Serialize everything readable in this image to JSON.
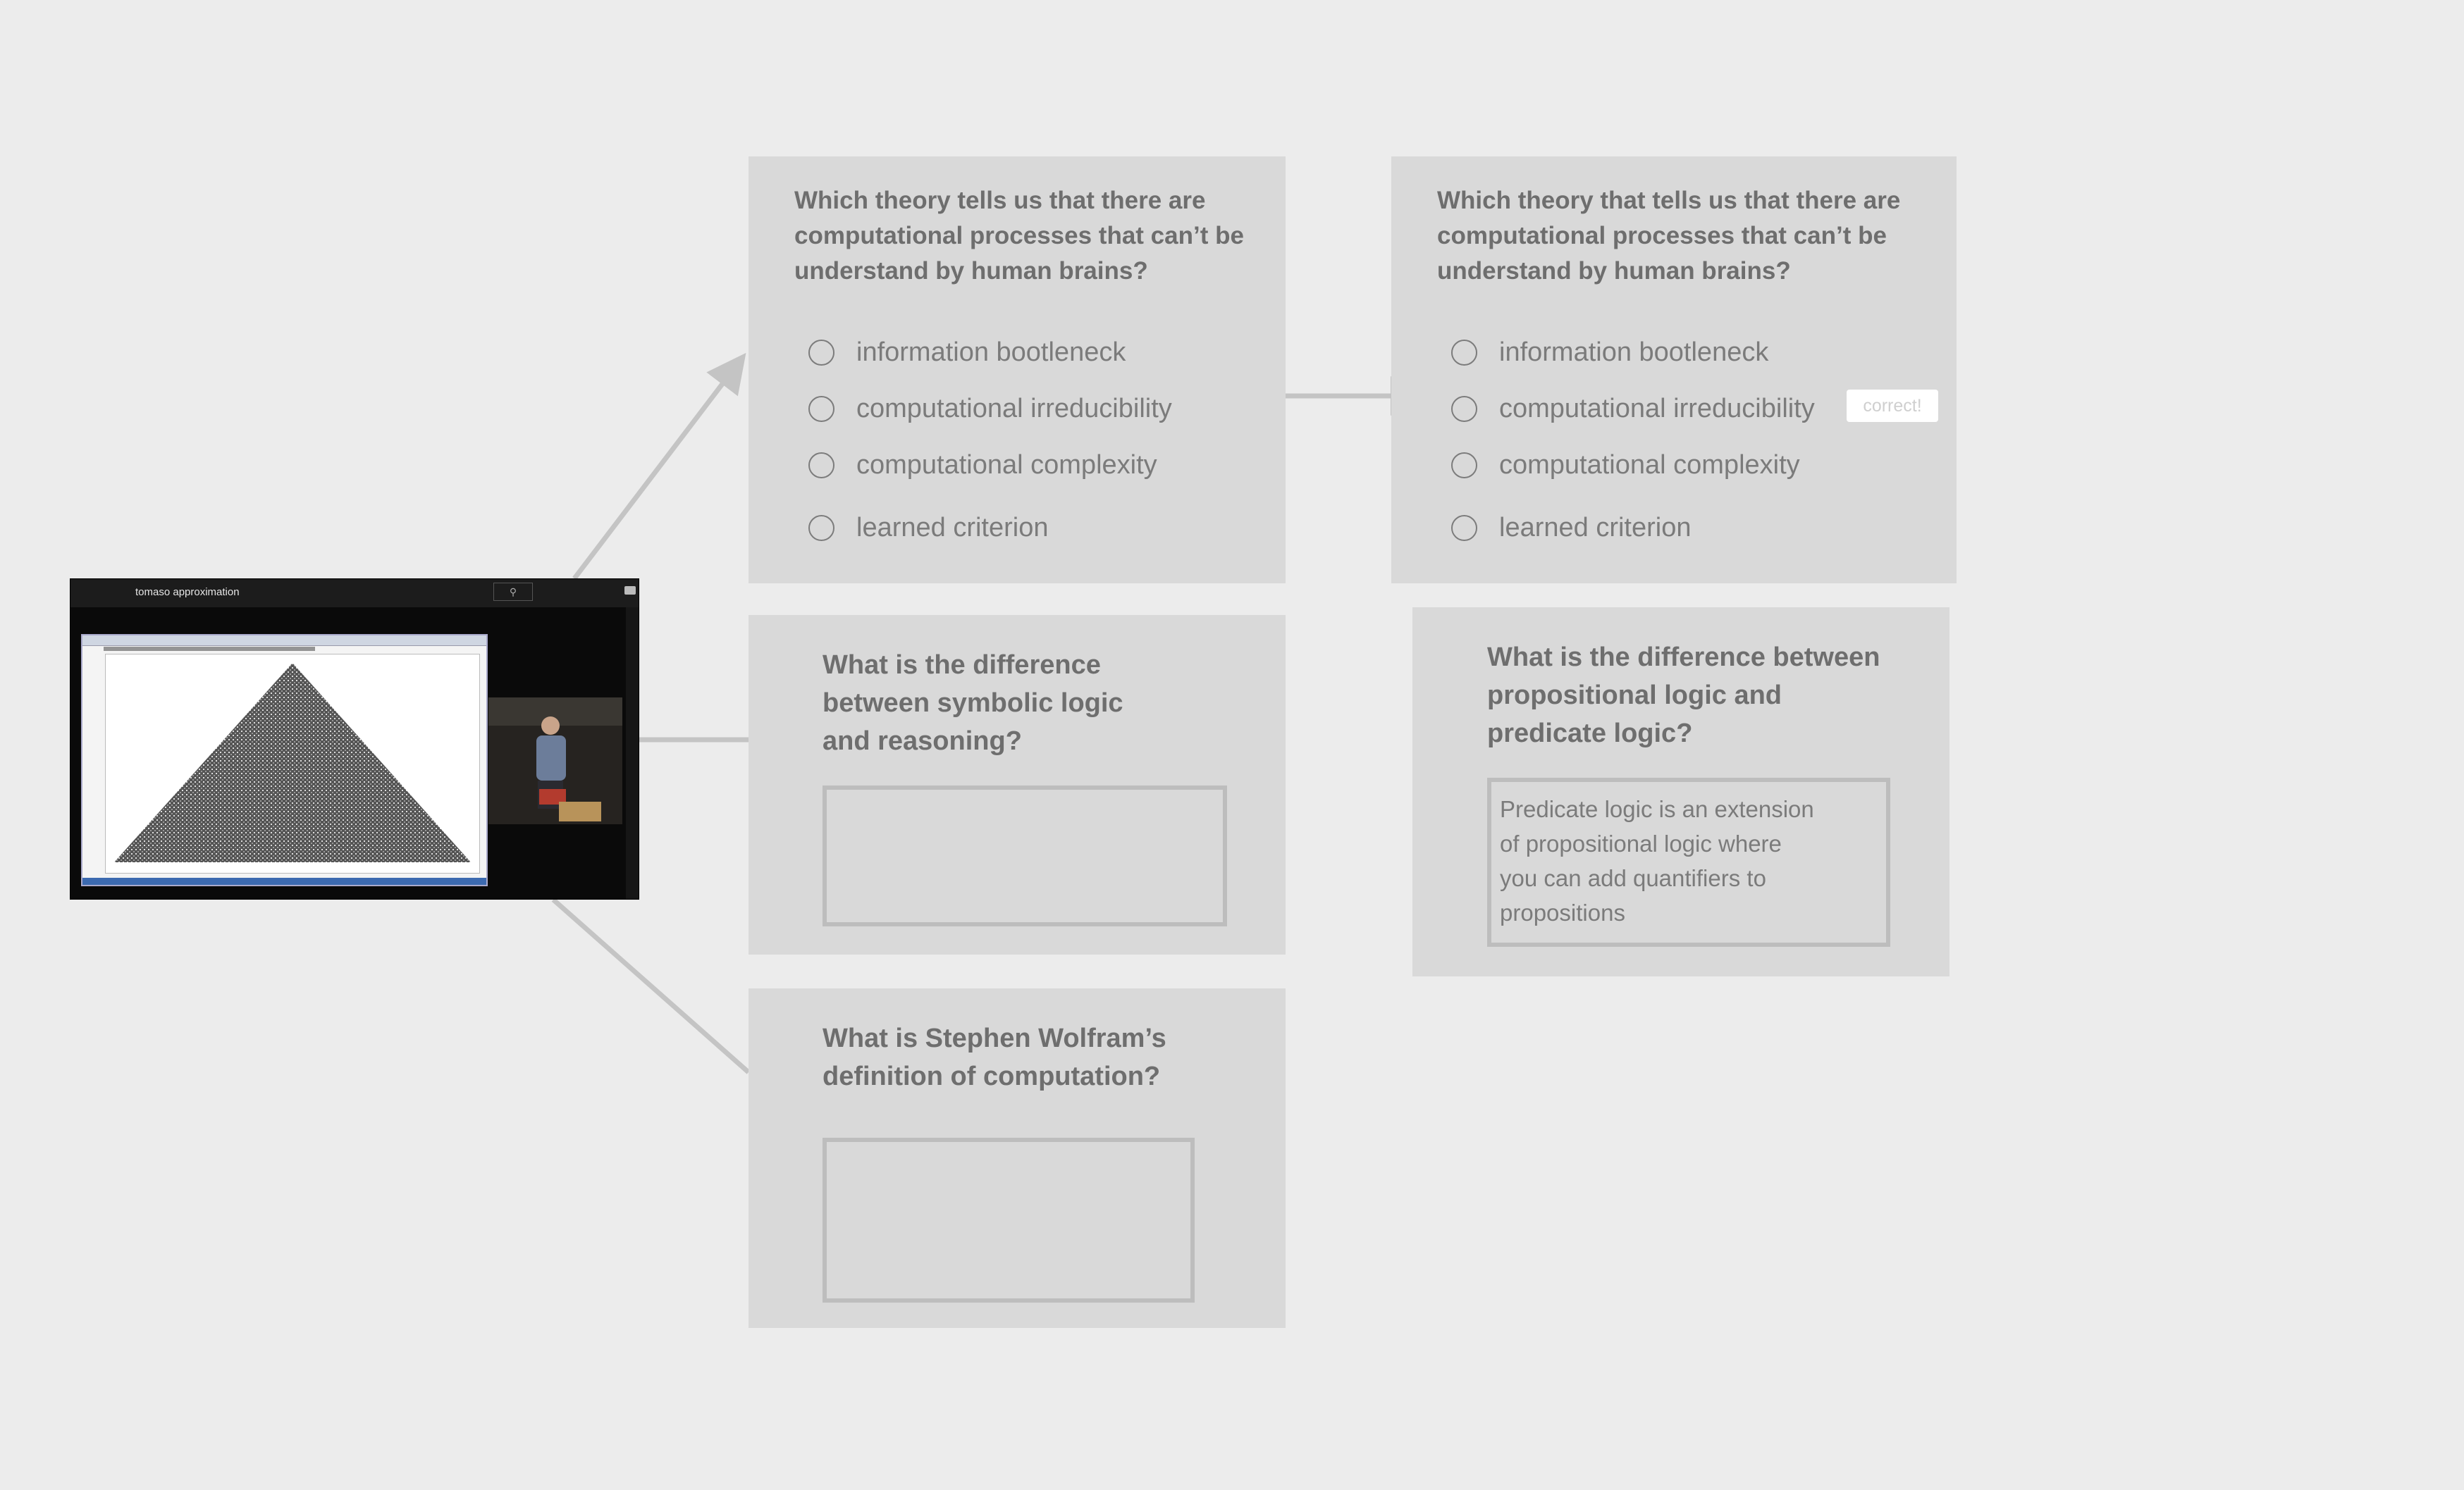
{
  "video": {
    "search_query": "tomaso approximation",
    "search_icon": "search-icon",
    "camera_icon": "video-camera-icon"
  },
  "quizzes": {
    "mc_unanswered": {
      "question": "Which theory tells us that there are computational processes that can’t be understand by human brains?",
      "options": [
        "information bootleneck",
        "computational irreducibility",
        "computational complexity",
        "learned criterion"
      ]
    },
    "mc_answered": {
      "question": "Which theory that tells us that there are computational processes that can’t be understand by human brains?",
      "options": [
        "information bootleneck",
        "computational irreducibility",
        "computational complexity",
        "learned criterion"
      ],
      "feedback": "correct!"
    },
    "open_symbolic": {
      "question": "What is the difference between symbolic logic and reasoning?",
      "answer": ""
    },
    "open_propositional": {
      "question": "What is the difference between propositional logic and predicate logic?",
      "answer": "Predicate logic is an extension of propositional logic where you can add quantifiers to propositions"
    },
    "open_wolfram": {
      "question": "What is Stephen Wolfram’s definition of computation?",
      "answer": ""
    }
  },
  "colors": {
    "background": "#ececec",
    "card": "#d9d9d9",
    "text": "#6e6e6e",
    "connector": "#c4c4c4"
  }
}
